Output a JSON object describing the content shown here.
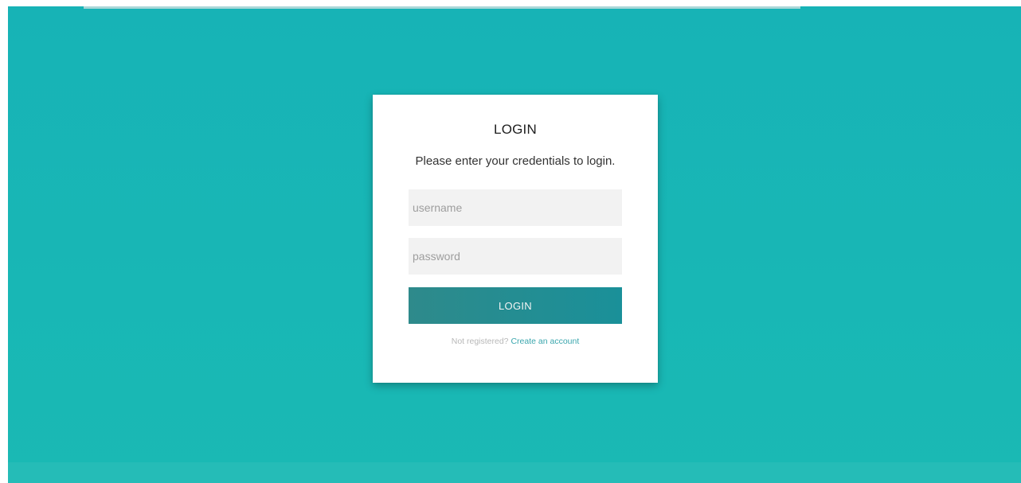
{
  "login": {
    "title": "LOGIN",
    "subtitle": "Please enter your credentials to login.",
    "username_placeholder": "username",
    "password_placeholder": "password",
    "button_label": "LOGIN",
    "register_prompt": "Not registered?",
    "register_link": "Create an account"
  },
  "colors": {
    "background": "#17b4b6",
    "button": "#268f95",
    "link": "#3aa6ad"
  }
}
